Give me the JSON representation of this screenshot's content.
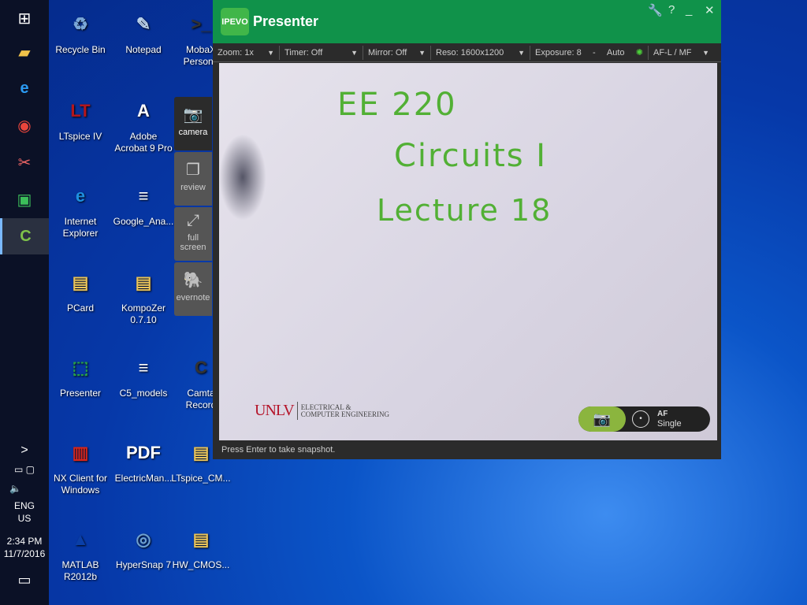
{
  "taskbar": {
    "items": [
      "windows-start",
      "file-explorer",
      "internet-explorer",
      "chrome",
      "snipping-tool",
      "ipevo-presenter",
      "camtasia"
    ],
    "tray": {
      "expand": ">",
      "language": "ENG",
      "region": "US",
      "time": "2:34 PM",
      "date": "11/7/2016"
    }
  },
  "desktop": {
    "icons": [
      {
        "label": "Recycle Bin",
        "glyph": "♻",
        "color": "#7aa7d8"
      },
      {
        "label": "Notepad",
        "glyph": "✎",
        "color": "#bcd4ee"
      },
      {
        "label": "MobaX\nPersona",
        "glyph": ">_",
        "color": "#333"
      },
      {
        "label": "LTspice IV",
        "glyph": "LT",
        "color": "#b3161c"
      },
      {
        "label": "Adobe\nAcrobat 9 Pro",
        "glyph": "A",
        "color": "#fff"
      },
      {
        "label": "Internet\nExplorer",
        "glyph": "e",
        "color": "#1e90e0"
      },
      {
        "label": "Google_Ana...",
        "glyph": "≡",
        "color": "#fff"
      },
      {
        "label": "PCard",
        "glyph": "▤",
        "color": "#e8c35a"
      },
      {
        "label": "KompoZer\n0.7.10",
        "glyph": "▤",
        "color": "#e8c35a"
      },
      {
        "label": "Presenter",
        "glyph": "⬚",
        "color": "#28a047"
      },
      {
        "label": "C5_models",
        "glyph": "≡",
        "color": "#fff"
      },
      {
        "label": "Camta\nRecord",
        "glyph": "C",
        "color": "#333"
      },
      {
        "label": "NX Client for\nWindows",
        "glyph": "▥",
        "color": "#d8261c"
      },
      {
        "label": "ElectricMan...",
        "glyph": "PDF",
        "color": "#fff"
      },
      {
        "label": "LTspice_CM...",
        "glyph": "▤",
        "color": "#e8c35a"
      },
      {
        "label": "MATLAB\nR2012b",
        "glyph": "▲",
        "color": "#0a3fa8"
      },
      {
        "label": "HyperSnap 7",
        "glyph": "◎",
        "color": "#6ea0d0"
      },
      {
        "label": "HW_CMOS...",
        "glyph": "▤",
        "color": "#e8c35a"
      }
    ]
  },
  "side_panel": {
    "camera": "camera",
    "review": "review",
    "full_screen": "full\nscreen",
    "evernote": "evernote"
  },
  "window": {
    "logo": "IPEVO",
    "title": "Presenter",
    "toolbar": {
      "zoom": "Zoom: 1x",
      "timer": "Timer: Off",
      "mirror": "Mirror: Off",
      "reso": "Reso: 1600x1200",
      "exposure": "Exposure: 8",
      "minus": "-",
      "auto": "Auto",
      "af": "AF-L / MF"
    },
    "view": {
      "line1": "EE 220",
      "line2": "Circuits I",
      "line3": "Lecture 18",
      "unlv": "UNLV",
      "dept1": "ELECTRICAL &",
      "dept2": "COMPUTER ENGINEERING"
    },
    "af_label": "AF",
    "af_mode": "Single",
    "status": "Press Enter to take snapshot."
  },
  "accent": "#10924a"
}
